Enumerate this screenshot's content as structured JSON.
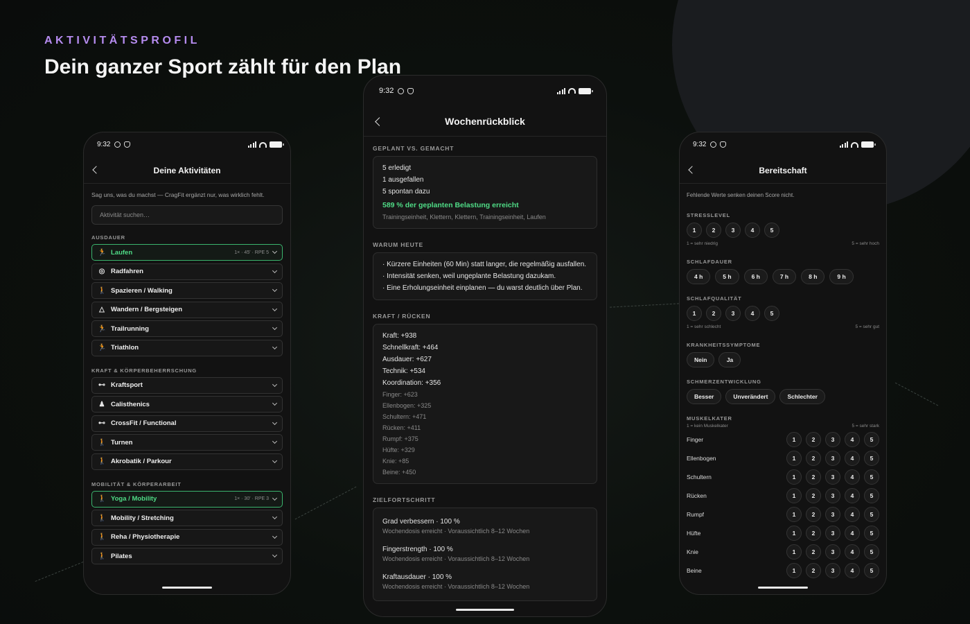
{
  "eyebrow": "AKTIVITÄTSPROFIL",
  "headline": "Dein ganzer Sport zählt für den Plan",
  "status_time": "9:32",
  "activities": {
    "title": "Deine Aktivitäten",
    "intro": "Sag uns, was du machst — CragFit ergänzt nur, was wirklich fehlt.",
    "search_placeholder": "Aktivität suchen…",
    "sections": [
      {
        "heading": "AUSDAUER",
        "items": [
          {
            "label": "Laufen",
            "icon": "running-icon",
            "glyph": "🏃",
            "selected": true,
            "meta": "1× · 45' · RPE 5"
          },
          {
            "label": "Radfahren",
            "icon": "cycling-icon",
            "glyph": "◎"
          },
          {
            "label": "Spazieren / Walking",
            "icon": "walking-icon",
            "glyph": "🚶"
          },
          {
            "label": "Wandern / Bergsteigen",
            "icon": "mountain-icon",
            "glyph": "△"
          },
          {
            "label": "Trailrunning",
            "icon": "running-icon",
            "glyph": "🏃"
          },
          {
            "label": "Triathlon",
            "icon": "running-icon",
            "glyph": "🏃"
          }
        ]
      },
      {
        "heading": "KRAFT & KÖRPERBEHERRSCHUNG",
        "items": [
          {
            "label": "Kraftsport",
            "icon": "dumbbell-icon",
            "glyph": "⊷"
          },
          {
            "label": "Calisthenics",
            "icon": "body-icon",
            "glyph": "♟"
          },
          {
            "label": "CrossFit / Functional",
            "icon": "dumbbell-icon",
            "glyph": "⊷"
          },
          {
            "label": "Turnen",
            "icon": "person-icon",
            "glyph": "🚶"
          },
          {
            "label": "Akrobatik / Parkour",
            "icon": "person-icon",
            "glyph": "🚶"
          }
        ]
      },
      {
        "heading": "MOBILITÄT & KÖRPERARBEIT",
        "items": [
          {
            "label": "Yoga / Mobility",
            "icon": "person-icon",
            "glyph": "🚶",
            "selected": true,
            "meta": "1× · 30' · RPE 3"
          },
          {
            "label": "Mobility / Stretching",
            "icon": "person-icon",
            "glyph": "🚶"
          },
          {
            "label": "Reha / Physiotherapie",
            "icon": "person-icon",
            "glyph": "🚶"
          },
          {
            "label": "Pilates",
            "icon": "person-icon",
            "glyph": "🚶"
          }
        ]
      }
    ]
  },
  "review": {
    "title": "Wochenrückblick",
    "planned_heading": "GEPLANT VS. GEMACHT",
    "planned_lines": [
      "5 erledigt",
      "1 ausgefallen",
      "5 spontan dazu"
    ],
    "load_text": "589 % der geplanten Belastung erreicht",
    "sessions_text": "Trainingseinheit, Klettern, Klettern, Trainingseinheit, Laufen",
    "why_heading": "WARUM HEUTE",
    "why_lines": [
      "· Kürzere Einheiten (60 Min) statt langer, die regelmäßig ausfallen.",
      "· Intensität senken, weil ungeplante Belastung dazukam.",
      "· Eine Erholungseinheit einplanen — du warst deutlich über Plan."
    ],
    "strength_heading": "KRAFT / RÜCKEN",
    "strength_main": [
      "Kraft: +938",
      "Schnellkraft: +464",
      "Ausdauer: +627",
      "Technik: +534",
      "Koordination: +356"
    ],
    "strength_parts": [
      "Finger: +623",
      "Ellenbogen: +325",
      "Schultern: +471",
      "Rücken: +411",
      "Rumpf: +375",
      "Hüfte: +329",
      "Knie: +85",
      "Beine: +450"
    ],
    "goal_heading": "ZIELFORTSCHRITT",
    "goals": [
      {
        "title": "Grad verbessern · 100 %",
        "sub": "Wochendosis erreicht · Voraussichtlich 8–12 Wochen"
      },
      {
        "title": "Fingerstrength · 100 %",
        "sub": "Wochendosis erreicht · Voraussichtlich 8–12 Wochen"
      },
      {
        "title": "Kraftausdauer · 100 %",
        "sub": "Wochendosis erreicht · Voraussichtlich 8–12 Wochen"
      }
    ]
  },
  "readiness": {
    "title": "Bereitschaft",
    "intro": "Fehlende Werte senken deinen Score nicht.",
    "stress_heading": "STRESSLEVEL",
    "stress_options": [
      "1",
      "2",
      "3",
      "4",
      "5"
    ],
    "stress_low": "1 = sehr niedrig",
    "stress_high": "5 = sehr hoch",
    "sleep_heading": "SCHLAFDAUER",
    "sleep_options": [
      "4 h",
      "5 h",
      "6 h",
      "7 h",
      "8 h",
      "9 h"
    ],
    "quality_heading": "SCHLAFQUALITÄT",
    "quality_options": [
      "1",
      "2",
      "3",
      "4",
      "5"
    ],
    "quality_low": "1 = sehr schlecht",
    "quality_high": "5 = sehr gut",
    "illness_heading": "KRANKHEITSSYMPTOME",
    "illness_options": [
      "Nein",
      "Ja"
    ],
    "pain_heading": "SCHMERZENTWICKLUNG",
    "pain_options": [
      "Besser",
      "Unverändert",
      "Schlechter"
    ],
    "soreness_heading": "MUSKELKATER",
    "soreness_low": "1 = kein Muskelkater",
    "soreness_high": "5 = sehr stark",
    "soreness_options": [
      "1",
      "2",
      "3",
      "4",
      "5"
    ],
    "muscles": [
      "Finger",
      "Ellenbogen",
      "Schultern",
      "Rücken",
      "Rumpf",
      "Hüfte",
      "Knie",
      "Beine"
    ]
  }
}
